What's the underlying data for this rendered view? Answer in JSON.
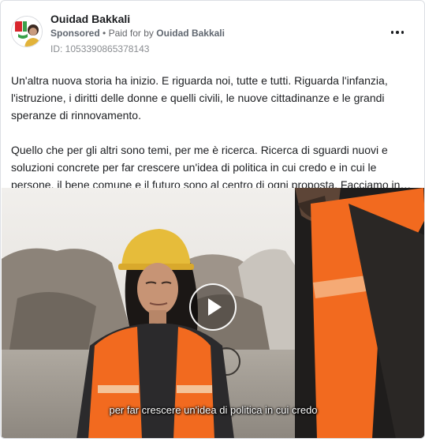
{
  "post": {
    "page_name": "Ouidad Bakkali",
    "sponsored_label": "Sponsored",
    "separator": "•",
    "paid_for_prefix": "Paid for by",
    "paid_for_name": "Ouidad Bakkali",
    "ad_id": "ID: 1053390865378143",
    "more_icon": "more-horizontal-icon",
    "body_paragraphs": [
      "Un'altra nuova storia ha inizio. E riguarda noi, tutte e tutti. Riguarda l'infanzia, l'istruzione, i diritti delle donne e quelli civili, le nuove cittadinanze e le grandi speranze di rinnovamento.",
      "Quello che per gli altri sono temi, per me è ricerca. Ricerca di sguardi nuovi e soluzioni concrete per far crescere un'idea di politica in cui credo e in cui le persone, il bene comune e il futuro sono al centro di ogni proposta. Facciamo in…"
    ]
  },
  "video": {
    "play_icon": "play-icon",
    "subtitle": "per far crescere un'idea di politica in cui credo"
  },
  "colors": {
    "card_border": "#dcdfe4",
    "text_primary": "#1c1e21",
    "text_secondary": "#65676b",
    "vest_orange": "#f26a1f",
    "helmet_yellow": "#e6bc3a",
    "logo_red": "#d8262d",
    "logo_green": "#3aa04a"
  }
}
